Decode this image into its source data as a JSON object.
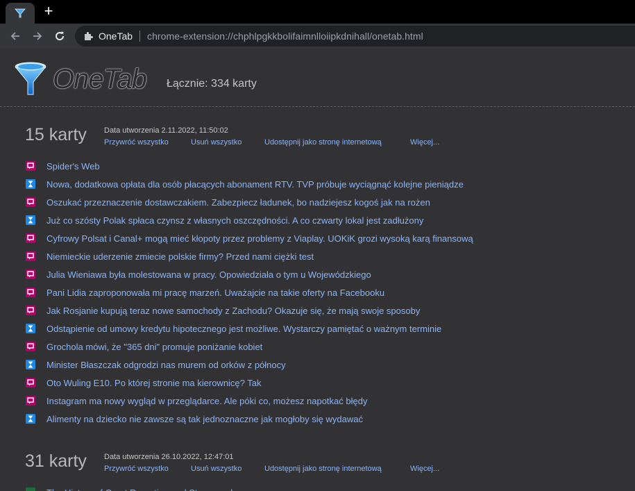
{
  "browser": {
    "omnibox": {
      "origin": "OneTab",
      "url": "chrome-extension://chphlpgkkbolifaimnlloiipkdnihall/onetab.html"
    }
  },
  "header": {
    "logo_text": "OneTab",
    "total": "Łącznie: 334 karty"
  },
  "groups": [
    {
      "count": "15 karty",
      "created": "Data utworzenia 2.11.2022, 11:50:02",
      "actions": [
        "Przywróć wszystko",
        "Usuń wszystko",
        "Udostępnij jako stronę internetową",
        "Więcej..."
      ],
      "items": [
        {
          "title": "Spider's Web",
          "icon": "spidersweb-icon"
        },
        {
          "title": "Nowa, dodatkowa opłata dla osób płacących abonament RTV. TVP próbuje wyciągnąć kolejne pieniądze",
          "icon": "hourglass-icon"
        },
        {
          "title": "Oszukać przeznaczenie dostawczakiem. Zabezpiecz ładunek, bo nadziejesz kogoś jak na rożen",
          "icon": "spidersweb-icon"
        },
        {
          "title": "Już co szósty Polak spłaca czynsz z własnych oszczędności. A co czwarty lokal jest zadłużony",
          "icon": "hourglass-icon"
        },
        {
          "title": "Cyfrowy Polsat i Canal+ mogą mieć kłopoty przez problemy z Viaplay. UOKiK grozi wysoką karą finansową",
          "icon": "spidersweb-icon"
        },
        {
          "title": "Niemieckie uderzenie zmiecie polskie firmy? Przed nami ciężki test",
          "icon": "spidersweb-icon"
        },
        {
          "title": "Julia Wieniawa była molestowana w pracy. Opowiedziała o tym u Wojewódzkiego",
          "icon": "spidersweb-icon"
        },
        {
          "title": "Pani Lidia zaproponowała mi pracę marzeń. Uważajcie na takie oferty na Facebooku",
          "icon": "spidersweb-icon"
        },
        {
          "title": "Jak Rosjanie kupują teraz nowe samochody z Zachodu? Okazuje się, że mają swoje sposoby",
          "icon": "spidersweb-icon"
        },
        {
          "title": "Odstąpienie od umowy kredytu hipotecznego jest możliwe. Wystarczy pamiętać o ważnym terminie",
          "icon": "hourglass-icon"
        },
        {
          "title": "Grochola mówi, że \"365 dni\" promuje poniżanie kobiet",
          "icon": "spidersweb-icon"
        },
        {
          "title": "Minister Błaszczak odgrodzi nas murem od orków z północy",
          "icon": "hourglass-icon"
        },
        {
          "title": "Oto Wuling E10. Po której stronie ma kierownicę? Tak",
          "icon": "spidersweb-icon"
        },
        {
          "title": "Instagram ma nowy wygląd w przeglądarce. Ale póki co, możesz napotkać błędy",
          "icon": "spidersweb-icon"
        },
        {
          "title": "Alimenty na dziecko nie zawsze są tak jednoznaczne jak mogłoby się wydawać",
          "icon": "hourglass-icon"
        }
      ]
    },
    {
      "count": "31 karty",
      "created": "Data utworzenia 26.10.2022, 12:47:01",
      "actions": [
        "Przywróć wszystko",
        "Usuń wszystko",
        "Udostępnij jako stronę internetową",
        "Więcej..."
      ],
      "items": [
        {
          "title": "The History of Court Reporting and Stenography",
          "icon": "green-site-icon"
        }
      ]
    }
  ],
  "colors": {
    "link": "#8ab4f8",
    "spidersweb": "#b4006a",
    "hourglass": "#1e88e5"
  }
}
